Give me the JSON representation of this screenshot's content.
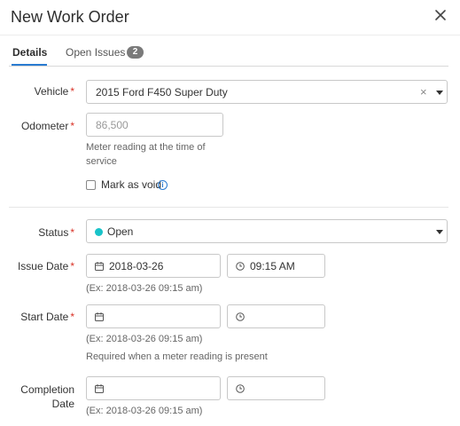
{
  "modal": {
    "title": "New Work Order"
  },
  "tabs": [
    {
      "label": "Details",
      "active": true
    },
    {
      "label": "Open Issues",
      "badge": "2"
    }
  ],
  "fields": {
    "vehicle": {
      "label": "Vehicle",
      "required": "*",
      "value": "2015 Ford F450 Super Duty"
    },
    "odometer": {
      "label": "Odometer",
      "required": "*",
      "placeholder": "86,500",
      "help": "Meter reading at the time of service"
    },
    "void": {
      "label": "Mark as void"
    },
    "status": {
      "label": "Status",
      "required": "*",
      "value": "Open",
      "color": "#19c3c9"
    },
    "issue_date": {
      "label": "Issue Date",
      "required": "*",
      "date": "2018-03-26",
      "time": "09:15 AM",
      "example": "(Ex: 2018-03-26 09:15 am)"
    },
    "start_date": {
      "label": "Start Date",
      "required": "*",
      "date": "",
      "time": "",
      "example": "(Ex: 2018-03-26 09:15 am)",
      "help": "Required when a meter reading is present"
    },
    "completion_date": {
      "label_line1": "Completion",
      "label_line2": "Date",
      "date": "",
      "time": "",
      "example": "(Ex: 2018-03-26 09:15 am)"
    }
  },
  "colors": {
    "accent": "#2a7bd1",
    "required": "#d93025"
  }
}
